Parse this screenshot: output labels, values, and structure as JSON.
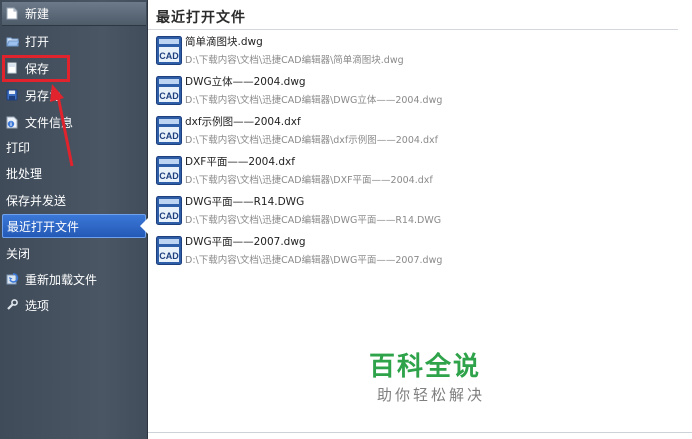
{
  "sidebar": {
    "items": [
      {
        "label": "新建",
        "icon": "new-file-icon"
      },
      {
        "label": "打开",
        "icon": "folder-open-icon"
      },
      {
        "label": "保存",
        "icon": "save-icon"
      },
      {
        "label": "另存为",
        "icon": "save-as-icon"
      },
      {
        "label": "文件信息",
        "icon": "file-info-icon"
      },
      {
        "label": "打印"
      },
      {
        "label": "批处理"
      },
      {
        "label": "保存并发送"
      },
      {
        "label": "最近打开文件"
      },
      {
        "label": "关闭"
      },
      {
        "label": "重新加载文件",
        "icon": "reload-icon"
      },
      {
        "label": "选项",
        "icon": "wrench-icon"
      }
    ],
    "active_index": 8
  },
  "main": {
    "title": "最近打开文件",
    "files": [
      {
        "name": "简单滴图块.dwg",
        "path": "D:\\下载内容\\文档\\迅捷CAD编辑器\\简单滴图块.dwg"
      },
      {
        "name": "DWG立体——2004.dwg",
        "path": "D:\\下载内容\\文档\\迅捷CAD编辑器\\DWG立体——2004.dwg"
      },
      {
        "name": "dxf示例图——2004.dxf",
        "path": "D:\\下载内容\\文档\\迅捷CAD编辑器\\dxf示例图——2004.dxf"
      },
      {
        "name": "DXF平面——2004.dxf",
        "path": "D:\\下载内容\\文档\\迅捷CAD编辑器\\DXF平面——2004.dxf"
      },
      {
        "name": "DWG平面——R14.DWG",
        "path": "D:\\下载内容\\文档\\迅捷CAD编辑器\\DWG平面——R14.DWG"
      },
      {
        "name": "DWG平面——2007.dwg",
        "path": "D:\\下载内容\\文档\\迅捷CAD编辑器\\DWG平面——2007.dwg"
      }
    ],
    "file_icon_text": "CAD"
  },
  "watermark": {
    "main": "百科全说",
    "sub": "助你轻松解决"
  },
  "colors": {
    "sidebar_bg": "#45515f",
    "active_bg": "#2e66c6",
    "annotation_red": "#e0232c",
    "watermark_green": "#2ea34a"
  }
}
